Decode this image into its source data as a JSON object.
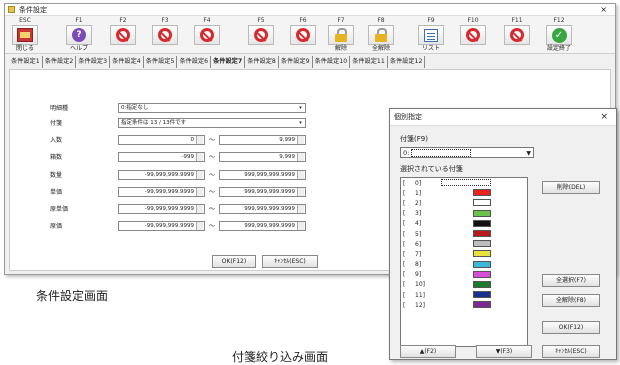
{
  "window": {
    "title": "条件設定",
    "close": "×"
  },
  "fkeys": [
    {
      "key": "ESC",
      "label": "閉じる",
      "icon": "close-door-icon"
    },
    {
      "key": "F1",
      "label": "ヘルプ",
      "icon": "help-icon"
    },
    {
      "key": "F2",
      "label": "",
      "icon": "disabled-icon"
    },
    {
      "key": "F3",
      "label": "",
      "icon": "disabled-icon"
    },
    {
      "key": "F4",
      "label": "",
      "icon": "disabled-icon"
    },
    {
      "key": "F5",
      "label": "",
      "icon": "disabled-icon"
    },
    {
      "key": "F6",
      "label": "",
      "icon": "disabled-icon"
    },
    {
      "key": "F7",
      "label": "解除",
      "icon": "unlock-icon"
    },
    {
      "key": "F8",
      "label": "全解除",
      "icon": "unlock-all-icon"
    },
    {
      "key": "F9",
      "label": "リスト",
      "icon": "list-icon"
    },
    {
      "key": "F10",
      "label": "",
      "icon": "disabled-icon"
    },
    {
      "key": "F11",
      "label": "",
      "icon": "disabled-icon"
    },
    {
      "key": "F12",
      "label": "設定終了",
      "icon": "check-icon"
    }
  ],
  "tabs": [
    "条件設定1",
    "条件設定2",
    "条件設定3",
    "条件設定4",
    "条件設定5",
    "条件設定6",
    "条件設定7",
    "条件設定8",
    "条件設定9",
    "条件設定10",
    "条件設定11",
    "条件設定12"
  ],
  "active_tab": 6,
  "form": {
    "meisai": {
      "label": "明細種",
      "value": "0:指定なし"
    },
    "fusen": {
      "label": "付箋",
      "value": "指定条件は 13 / 13件です"
    },
    "irisu": {
      "label": "入数",
      "from": "0",
      "to": "9,999"
    },
    "hakosu": {
      "label": "箱数",
      "from": "-999",
      "to": "9,999"
    },
    "suryo": {
      "label": "数量",
      "from": "-99,999,999.9999",
      "to": "999,999,999.9999"
    },
    "tanka": {
      "label": "単価",
      "from": "-99,999,999.9999",
      "to": "999,999,999.9999"
    },
    "gentanka": {
      "label": "原単価",
      "from": "-99,999,999.9999",
      "to": "999,999,999.9999"
    },
    "genka": {
      "label": "原価",
      "from": "-99,999,999.9999",
      "to": "999,999,999.9999"
    },
    "tilde": "～",
    "ok": "OK(F12)",
    "cancel": "ｷｬﾝｾﾙ(ESC)"
  },
  "captions": {
    "main": "条件設定画面",
    "dialog": "付箋絞り込み画面"
  },
  "dialog": {
    "title": "個別指定",
    "close": "×",
    "tag_label": "付箋(F9)",
    "tag_value": "0:",
    "selected_label": "選択されている付箋",
    "items": [
      {
        "n": "0",
        "color": "#ffffff"
      },
      {
        "n": "1",
        "color": "#e8231f"
      },
      {
        "n": "2",
        "color": "#ffffff"
      },
      {
        "n": "3",
        "color": "#6cc24a"
      },
      {
        "n": "4",
        "color": "#111111"
      },
      {
        "n": "5",
        "color": "#b71c1c"
      },
      {
        "n": "6",
        "color": "#bdbdbd"
      },
      {
        "n": "7",
        "color": "#e9e23a"
      },
      {
        "n": "8",
        "color": "#3fb6d8"
      },
      {
        "n": "9",
        "color": "#d64fd6"
      },
      {
        "n": "10",
        "color": "#1b7a2e"
      },
      {
        "n": "11",
        "color": "#1c2e8e"
      },
      {
        "n": "12",
        "color": "#7b2a90"
      }
    ],
    "delete": "削除(DEL)",
    "select_all": "全選択(F7)",
    "clear_all": "全解除(F8)",
    "ok": "OK(F12)",
    "up": "▲(F2)",
    "down": "▼(F3)",
    "cancel": "ｷｬﾝｾﾙ(ESC)"
  }
}
